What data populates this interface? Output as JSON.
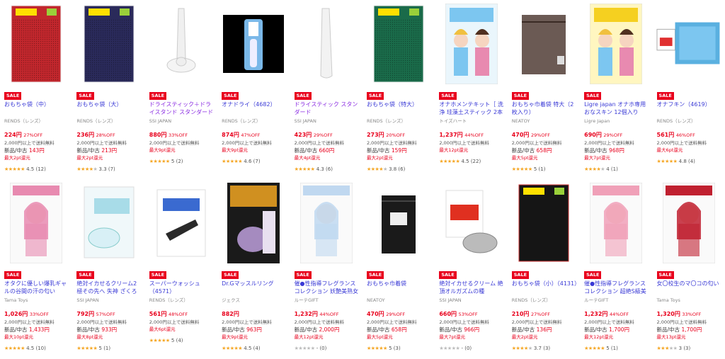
{
  "sale_label": "SALE",
  "products_row1": [
    {
      "title": "おもちゃ袋（中）",
      "brand": "RENDS（レンズ）",
      "price": "224円",
      "off": "27%OFF",
      "ship": "2,000円以上で送料無料",
      "newused": "新品/中古 143円",
      "points": "最大2pt還元",
      "stars": 4.5,
      "rating": "4.5 (12)",
      "image": "red-mesh-bag",
      "color": "#c1272d"
    },
    {
      "title": "おもちゃ袋（大）",
      "brand": "RENDS（レンズ）",
      "price": "236円",
      "off": "28%OFF",
      "ship": "2,000円以上で送料無料",
      "newused": "新品/中古 213円",
      "points": "最大2pt還元",
      "stars": 3.5,
      "rating": "3.3 (7)",
      "image": "navy-mesh-bag",
      "color": "#2a2a5a"
    },
    {
      "title": "ドライスティック＋ドライスタンド スタンダード",
      "brand": "SSI JAPAN",
      "price": "880円",
      "off": "33%OFF",
      "ship": "2,000円以上で送料無料",
      "newused": "",
      "points": "最大9pt還元",
      "stars": 5,
      "rating": "5 (2)",
      "image": "white-stick-stand",
      "color": "#eeeeee"
    },
    {
      "title": "オナドライ（4682）",
      "brand": "RENDS（レンズ）",
      "price": "874円",
      "off": "47%OFF",
      "ship": "2,000円以上で送料無料",
      "newused": "",
      "points": "最大9pt還元",
      "stars": 4.5,
      "rating": "4.6 (7)",
      "image": "black-package",
      "color": "#111111"
    },
    {
      "title": "ドライスティック スタンダード",
      "brand": "SSI JAPAN",
      "price": "423円",
      "off": "29%OFF",
      "ship": "2,000円以上で送料無料",
      "newused": "新品/中古 660円",
      "points": "最大4pt還元",
      "stars": 4.5,
      "rating": "4.3 (6)",
      "image": "white-stick",
      "color": "#eeeeee"
    },
    {
      "title": "おもちゃ袋（特大）",
      "brand": "RENDS（レンズ）",
      "price": "273円",
      "off": "20%OFF",
      "ship": "2,000円以上で送料無料",
      "newused": "新品/中古 159円",
      "points": "最大2pt還元",
      "stars": 4,
      "rating": "3.8 (6)",
      "image": "green-mesh-bag",
      "color": "#1a6b4a"
    },
    {
      "title": "オナホメンテキット［ 洗浄 珪藻土スティック 2本 ...",
      "brand": "トイズハート",
      "price": "1,237円",
      "off": "44%OFF",
      "ship": "2,000円以上で送料無料",
      "newused": "",
      "points": "最大12pt還元",
      "stars": 4.5,
      "rating": "4.5 (22)",
      "image": "anime-box",
      "color": "#7cc6f0"
    },
    {
      "title": "おもちゃ巾着袋 特大（2枚入り）",
      "brand": "NEATOY",
      "price": "470円",
      "off": "29%OFF",
      "ship": "2,000円以上で送料無料",
      "newused": "新品/中古 658円",
      "points": "最大5pt還元",
      "stars": 5,
      "rating": "5 (1)",
      "image": "brown-drawstring",
      "color": "#6b5a54"
    },
    {
      "title": "Ligre japan オナホ専用 おなスキン 12個入り",
      "brand": "Ligre Japan",
      "price": "690円",
      "off": "29%OFF",
      "ship": "2,000円以上で送料無料",
      "newused": "新品/中古 968円",
      "points": "最大7pt還元",
      "stars": 4,
      "rating": "4 (1)",
      "image": "anime-box-yellow",
      "color": "#f5d020"
    },
    {
      "title": "オナフキン（4619）",
      "brand": "RENDS（レンズ）",
      "price": "561円",
      "off": "46%OFF",
      "ship": "2,000円以上で送料無料",
      "newused": "",
      "points": "最大6pt還元",
      "stars": 5,
      "rating": "4.8 (4)",
      "image": "blue-cloth",
      "color": "#5ab0e0"
    }
  ],
  "products_row2": [
    {
      "title": "オタクに優しい爆乳ギャルの谷間の汗の匂い",
      "brand": "Tama Toys",
      "price": "1,026円",
      "off": "33%OFF",
      "ship": "2,000円以上で送料無料",
      "newused": "新品/中古 1,433円",
      "points": "最大10pt還元",
      "stars": 4.5,
      "rating": "4.5 (10)",
      "image": "anime-box-gal",
      "color": "#e88ab0"
    },
    {
      "title": "絶対イカせるクリーム2 極その先へ 失神 ざくろの種",
      "brand": "SSI JAPAN",
      "price": "792円",
      "off": "57%OFF",
      "ship": "2,000円以上で送料無料",
      "newused": "新品/中古 933円",
      "points": "最大8pt還元",
      "stars": 5,
      "rating": "5 (1)",
      "image": "cream-jar-blue",
      "color": "#a8dce8"
    },
    {
      "title": "スーパーウォッシュ（4571）",
      "brand": "RENDS（レンズ）",
      "price": "561円",
      "off": "48%OFF",
      "ship": "2,000円以上で送料無料",
      "newused": "",
      "points": "最大6pt還元",
      "stars": 5,
      "rating": "5 (4)",
      "image": "black-washer",
      "color": "#2a2a2a"
    },
    {
      "title": "Dr.Gマッスルリング",
      "brand": "ジェクス",
      "price": "882円",
      "off": "",
      "ship": "2,000円以上で送料無料",
      "newused": "新品/中古 963円",
      "points": "最大9pt還元",
      "stars": 4.5,
      "rating": "4.5 (4)",
      "image": "purple-ring-pack",
      "color": "#6a3a9a"
    },
    {
      "title": "催●性指導フレグランスコレクション 妖艶美熟女 ...",
      "brand": "ルーテGIFT",
      "price": "1,232円",
      "off": "44%OFF",
      "ship": "2,000円以上で送料無料",
      "newused": "新品/中古 2,000円",
      "points": "最大12pt還元",
      "stars": 0,
      "rating": "- (0)",
      "image": "anime-box-teacher",
      "color": "#c0d8f0"
    },
    {
      "title": "おもちゃ巾着袋",
      "brand": "NEATOY",
      "price": "470円",
      "off": "29%OFF",
      "ship": "2,000円以上で送料無料",
      "newused": "新品/中古 658円",
      "points": "最大5pt還元",
      "stars": 5,
      "rating": "5 (3)",
      "image": "black-drawstring",
      "color": "#1a1a1a"
    },
    {
      "title": "絶対イカせるクリーム 絶頂オルガズムの種",
      "brand": "SSI JAPAN",
      "price": "660円",
      "off": "53%OFF",
      "ship": "2,000円以上で送料無料",
      "newused": "新品/中古 966円",
      "points": "最大7pt還元",
      "stars": 0,
      "rating": "- (0)",
      "image": "cream-jar-red",
      "color": "#e03020"
    },
    {
      "title": "おもちゃ袋（小）（4131）",
      "brand": "RENDS（レンズ）",
      "price": "210円",
      "off": "27%OFF",
      "ship": "2,000円以上で送料無料",
      "newused": "新品/中古 136円",
      "points": "最大2pt還元",
      "stars": 3.5,
      "rating": "3.7 (3)",
      "image": "black-mesh-bag",
      "color": "#111111"
    },
    {
      "title": "催●性指導フレグランスコレクション 超絶S級美熟...",
      "brand": "ルーテGIFT",
      "price": "1,232円",
      "off": "44%OFF",
      "ship": "2,000円以上で送料無料",
      "newused": "新品/中古 1,700円",
      "points": "最大12pt還元",
      "stars": 5,
      "rating": "5 (1)",
      "image": "anime-box-pink",
      "color": "#f0a0b8"
    },
    {
      "title": "女〇校生のマ〇コの匂い",
      "brand": "Tama Toys",
      "price": "1,320円",
      "off": "33%OFF",
      "ship": "2,000円以上で送料無料",
      "newused": "新品/中古 1,700円",
      "points": "最大13pt還元",
      "stars": 3,
      "rating": "3 (3)",
      "image": "anime-box-red",
      "color": "#c02030"
    }
  ]
}
